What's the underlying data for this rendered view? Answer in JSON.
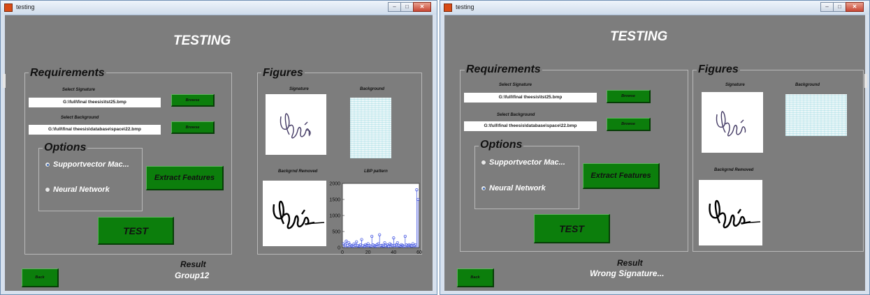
{
  "windows": [
    {
      "title": "testing",
      "heading": "TESTING",
      "requirements": {
        "title": "Requirements",
        "select_signature_label": "Select Signature",
        "signature_path": "G:\\full\\final theesis\\tst25.bmp",
        "select_background_label": "Select Background",
        "background_path": "G:\\full\\final theesis\\database\\space\\22.bmp",
        "browse_label": "Browse"
      },
      "options": {
        "title": "Options",
        "svm_label": "Supportvector Mac...",
        "nn_label": "Neural Network",
        "selected": "svm"
      },
      "extract_label": "Extract Features",
      "test_label": "TEST",
      "figures": {
        "title": "Figures",
        "signature_label": "Signature",
        "background_label": "Background",
        "removed_label": "Backgrnd Removed",
        "lbp_label": "LBP pattern"
      },
      "result_label": "Result",
      "result_value": "Group12",
      "back_label": "Back"
    },
    {
      "title": "testing",
      "heading": "TESTING",
      "requirements": {
        "title": "Requirements",
        "select_signature_label": "Select Signature",
        "signature_path": "G:\\full\\final theesis\\tst25.bmp",
        "select_background_label": "Select Background",
        "background_path": "G:\\full\\final theesis\\database\\space\\22.bmp",
        "browse_label": "Browse"
      },
      "options": {
        "title": "Options",
        "svm_label": "Supportvector Mac...",
        "nn_label": "Neural Network",
        "selected": "nn"
      },
      "extract_label": "Extract Features",
      "test_label": "TEST",
      "figures": {
        "title": "Figures",
        "signature_label": "Signature",
        "background_label": "Background",
        "removed_label": "Backgrnd Removed"
      },
      "result_label": "Result",
      "result_value": "Wrong Signature...",
      "back_label": "Back"
    }
  ],
  "chart_data": {
    "type": "scatter",
    "title": "LBP pattern",
    "xlabel": "",
    "ylabel": "",
    "xlim": [
      0,
      60
    ],
    "ylim": [
      0,
      2000
    ],
    "xticks": [
      0,
      20,
      40,
      60
    ],
    "yticks": [
      0,
      500,
      1000,
      1500,
      2000
    ],
    "x": [
      1,
      2,
      3,
      4,
      5,
      6,
      7,
      8,
      9,
      10,
      11,
      12,
      13,
      14,
      15,
      16,
      17,
      18,
      19,
      20,
      21,
      22,
      23,
      24,
      25,
      26,
      27,
      28,
      29,
      30,
      31,
      32,
      33,
      34,
      35,
      36,
      37,
      38,
      39,
      40,
      41,
      42,
      43,
      44,
      45,
      46,
      47,
      48,
      49,
      50,
      51,
      52,
      53,
      54,
      55,
      56,
      57,
      58,
      59
    ],
    "y": [
      120,
      80,
      200,
      60,
      150,
      90,
      60,
      40,
      110,
      70,
      180,
      60,
      50,
      80,
      250,
      60,
      40,
      90,
      70,
      120,
      60,
      50,
      350,
      80,
      60,
      40,
      90,
      120,
      400,
      60,
      70,
      50,
      150,
      60,
      80,
      40,
      120,
      90,
      60,
      300,
      70,
      80,
      150,
      60,
      50,
      90,
      70,
      40,
      350,
      80,
      60,
      90,
      70,
      50,
      120,
      60,
      80,
      1800,
      1500
    ],
    "series_color": "#3a4de0"
  }
}
